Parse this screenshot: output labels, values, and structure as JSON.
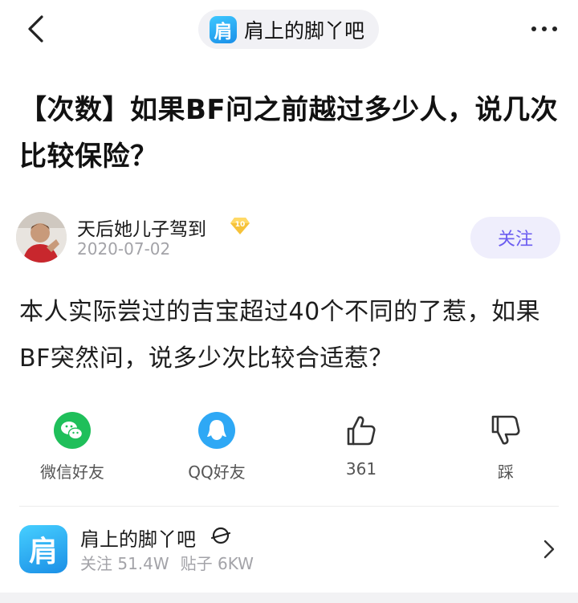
{
  "nav": {
    "forum_pill_label": "肩上的脚丫吧",
    "forum_logo_char": "肩"
  },
  "post": {
    "title": "【次数】如果BF问之前越过多少人，说几次比较保险？",
    "body": "本人实际尝过的吉宝超过40个不同的了惹，如果BF突然问，说多少次比较合适惹？"
  },
  "author": {
    "name": "天后她儿子驾到",
    "level": "10",
    "date": "2020-07-02",
    "follow_label": "关注"
  },
  "actions": {
    "wechat_label": "微信好友",
    "qq_label": "QQ好友",
    "like_count": "361",
    "dislike_label": "踩"
  },
  "forum_card": {
    "logo_char": "肩",
    "name": "肩上的脚丫吧",
    "followers": "关注 51.4W",
    "posts": "贴子 6KW"
  },
  "colors": {
    "accent": "#6b5cf0",
    "follow_bg": "#efeefc",
    "wechat_green": "#1fbf5a",
    "qq_blue": "#2ea8f5",
    "forum_blue": "#1b8fe6"
  }
}
